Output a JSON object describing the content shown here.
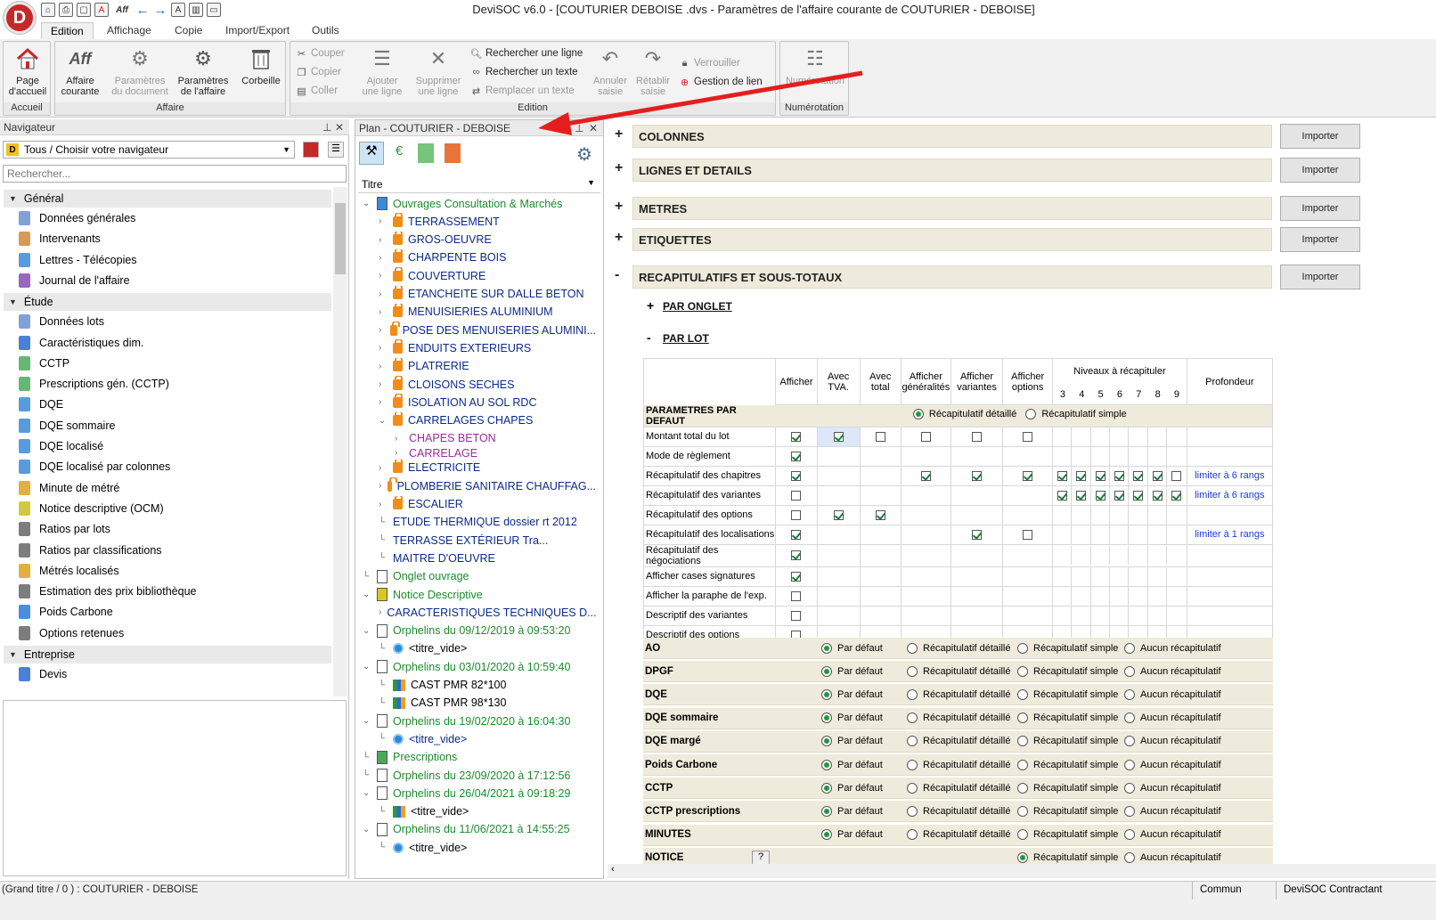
{
  "window": {
    "title": "DeviSOC v6.0 - [COUTURIER DEBOISE .dvs - Paramètres de l'affaire courante de COUTURIER - DEBOISE]",
    "logo_letter": "D"
  },
  "quick_access": [
    "home-icon",
    "print-icon",
    "new-icon",
    "pdf-icon",
    "aff-icon",
    "back-icon",
    "forward-icon",
    "a-icon",
    "layout-icon",
    "window-icon"
  ],
  "tabs": [
    "Edition",
    "Affichage",
    "Copie",
    "Import/Export",
    "Outils"
  ],
  "ribbon": {
    "accueil": {
      "label": "Accueil",
      "btn": "Page\nd'accueil"
    },
    "affaire": {
      "label": "Affaire",
      "aff": "Affaire\ncourante",
      "params_doc": "Paramètres\ndu document",
      "params_aff": "Paramètres\nde l'affaire",
      "corbeille": "Corbeille"
    },
    "edition": {
      "label": "Edition",
      "couper": "Couper",
      "copier": "Copier",
      "coller": "Coller",
      "ajouter": "Ajouter\nune ligne",
      "supprimer": "Supprimer\nune ligne",
      "rech_ligne": "Rechercher une ligne",
      "rech_texte": "Rechercher un texte",
      "remplacer": "Remplacer un texte",
      "annuler": "Annuler\nsaisie",
      "retablir": "Rétablir\nsaisie",
      "verrouiller": "Verrouiller",
      "gestion_lien": "Gestion de lien"
    },
    "numerotation": {
      "label": "Numérotation",
      "btn": "Numérotation"
    }
  },
  "navigator": {
    "title": "Navigateur",
    "selector": "Tous / Choisir votre navigateur",
    "search_placeholder": "Rechercher...",
    "groups": [
      {
        "name": "Général",
        "items": [
          "Données générales",
          "Intervenants",
          "Lettres - Télécopies",
          "Journal de l'affaire"
        ]
      },
      {
        "name": "Étude",
        "items": [
          "Données lots",
          "Caractéristiques dim.",
          "CCTP",
          "Prescriptions gén. (CCTP)",
          "DQE",
          "DQE sommaire",
          "DQE localisé",
          "DQE localisé par colonnes",
          "Minute de métré",
          "Notice descriptive (OCM)",
          "Ratios par lots",
          "Ratios par classifications",
          "Métrés localisés",
          "Estimation des prix bibliothèque",
          "Poids Carbone",
          "Options retenues"
        ]
      },
      {
        "name": "Entreprise",
        "items": [
          "Devis"
        ]
      }
    ]
  },
  "plan": {
    "title": "Plan - COUTURIER - DEBOISE",
    "column": "Titre",
    "rows": [
      {
        "t": "Ouvrages Consultation & Marchés",
        "lvl": 0,
        "c": "green",
        "ic": "doc-blue",
        "exp": "v"
      },
      {
        "t": "TERRASSEMENT",
        "lvl": 1,
        "c": "navy",
        "ic": "lock",
        "exp": ">"
      },
      {
        "t": "GROS-OEUVRE",
        "lvl": 1,
        "c": "navy",
        "ic": "lock",
        "exp": ">"
      },
      {
        "t": "CHARPENTE BOIS",
        "lvl": 1,
        "c": "navy",
        "ic": "lock",
        "exp": ">"
      },
      {
        "t": "COUVERTURE",
        "lvl": 1,
        "c": "navy",
        "ic": "lock",
        "exp": ">"
      },
      {
        "t": "ETANCHEITE SUR  DALLE BETON",
        "lvl": 1,
        "c": "navy",
        "ic": "lock",
        "exp": ">"
      },
      {
        "t": "MENUISIERIES ALUMINIUM",
        "lvl": 1,
        "c": "navy",
        "ic": "lock",
        "exp": ">"
      },
      {
        "t": "POSE DES MENUISERIES ALUMINI...",
        "lvl": 1,
        "c": "navy",
        "ic": "lock",
        "exp": ">"
      },
      {
        "t": "ENDUITS EXTERIEURS",
        "lvl": 1,
        "c": "navy",
        "ic": "lock",
        "exp": ">"
      },
      {
        "t": "PLATRERIE",
        "lvl": 1,
        "c": "navy",
        "ic": "lock",
        "exp": ">"
      },
      {
        "t": "CLOISONS SECHES",
        "lvl": 1,
        "c": "navy",
        "ic": "lock",
        "exp": ">"
      },
      {
        "t": "ISOLATION AU SOL RDC",
        "lvl": 1,
        "c": "navy",
        "ic": "lock",
        "exp": ">"
      },
      {
        "t": "CARRELAGES CHAPES",
        "lvl": 1,
        "c": "navy",
        "ic": "lock",
        "exp": "v"
      },
      {
        "t": "CHAPES BETON",
        "lvl": 2,
        "c": "purple",
        "ic": "",
        "exp": ">"
      },
      {
        "t": "CARRELAGE",
        "lvl": 2,
        "c": "purple",
        "ic": "",
        "exp": ">"
      },
      {
        "t": "ELECTRICITE",
        "lvl": 1,
        "c": "navy",
        "ic": "lock",
        "exp": ">"
      },
      {
        "t": "PLOMBERIE SANITAIRE CHAUFFAG...",
        "lvl": 1,
        "c": "navy",
        "ic": "lock",
        "exp": ">"
      },
      {
        "t": "ESCALIER",
        "lvl": 1,
        "c": "navy",
        "ic": "lock",
        "exp": ">"
      },
      {
        "t": "ETUDE THERMIQUE dossier rt 2012",
        "lvl": 1,
        "c": "navy",
        "ic": "",
        "exp": ""
      },
      {
        "t": "TERRASSE  EXTÉRIEUR            Tra...",
        "lvl": 1,
        "c": "navy",
        "ic": "",
        "exp": ""
      },
      {
        "t": "MAITRE D'OEUVRE",
        "lvl": 1,
        "c": "navy",
        "ic": "",
        "exp": ""
      },
      {
        "t": "Onglet ouvrage",
        "lvl": 0,
        "c": "green",
        "ic": "doc",
        "exp": ""
      },
      {
        "t": "Notice Descriptive",
        "lvl": 0,
        "c": "green",
        "ic": "doc-yellow",
        "exp": "v"
      },
      {
        "t": "CARACTERISTIQUES TECHNIQUES D...",
        "lvl": 1,
        "c": "navy",
        "ic": "",
        "exp": ">"
      },
      {
        "t": "Orphelins du 09/12/2019 à 09:53:20",
        "lvl": 0,
        "c": "green",
        "ic": "doc",
        "exp": "v"
      },
      {
        "t": "<titre_vide>",
        "lvl": 1,
        "c": "black",
        "ic": "circle",
        "exp": ""
      },
      {
        "t": "Orphelins du 03/01/2020 à 10:59:40",
        "lvl": 0,
        "c": "green",
        "ic": "doc",
        "exp": "v"
      },
      {
        "t": "CAST PMR 82*100",
        "lvl": 1,
        "c": "black",
        "ic": "bars",
        "exp": ""
      },
      {
        "t": "CAST PMR 98*130",
        "lvl": 1,
        "c": "black",
        "ic": "bars",
        "exp": ""
      },
      {
        "t": "Orphelins du 19/02/2020 à 16:04:30",
        "lvl": 0,
        "c": "green",
        "ic": "doc",
        "exp": "v"
      },
      {
        "t": "<titre_vide>",
        "lvl": 1,
        "c": "navy",
        "ic": "circle",
        "exp": ""
      },
      {
        "t": "Prescriptions",
        "lvl": 0,
        "c": "green",
        "ic": "doc-green",
        "exp": ""
      },
      {
        "t": "Orphelins du 23/09/2020 à 17:12:56",
        "lvl": 0,
        "c": "green",
        "ic": "doc",
        "exp": ""
      },
      {
        "t": "Orphelins du 26/04/2021 à 09:18:29",
        "lvl": 0,
        "c": "green",
        "ic": "doc",
        "exp": "v"
      },
      {
        "t": "<titre_vide>",
        "lvl": 1,
        "c": "black",
        "ic": "bars",
        "exp": ""
      },
      {
        "t": "Orphelins du 11/06/2021 à 14:55:25",
        "lvl": 0,
        "c": "green",
        "ic": "doc",
        "exp": "v"
      },
      {
        "t": "<titre_vide>",
        "lvl": 1,
        "c": "black",
        "ic": "circle",
        "exp": ""
      }
    ]
  },
  "main": {
    "sections": [
      {
        "t": "COLONNES",
        "s": "+"
      },
      {
        "t": "LIGNES ET DETAILS",
        "s": "+"
      },
      {
        "t": "METRES",
        "s": "+"
      },
      {
        "t": "ETIQUETTES",
        "s": "+"
      },
      {
        "t": "RECAPITULATIFS ET SOUS-TOTAUX",
        "s": "-"
      }
    ],
    "import_label": "Importer",
    "sub": [
      {
        "t": "PAR ONGLET",
        "s": "+"
      },
      {
        "t": "PAR LOT",
        "s": "-"
      }
    ],
    "col_headers": [
      "Afficher",
      "Avec\nTVA.",
      "Avec\ntotal",
      "Afficher\ngénéralités",
      "Afficher\nvariantes",
      "Afficher\noptions",
      "Niveaux à récapituler",
      "Profondeur"
    ],
    "niveaux": [
      "3",
      "4",
      "5",
      "6",
      "7",
      "8",
      "9"
    ],
    "param_defaut": "PARAMETRES PAR DEFAUT",
    "recap_detaille": "Récapitulatif détaillé",
    "recap_simple": "Récapitulatif simple",
    "aucun": "Aucun récapitulatif",
    "par_defaut": "Par défaut",
    "rows": [
      {
        "l": "Montant total du lot",
        "c": [
          1,
          1,
          0,
          0,
          0,
          0
        ],
        "n": [],
        "p": ""
      },
      {
        "l": "Mode de règlement",
        "c": [
          1,
          null,
          null,
          null,
          null,
          null
        ],
        "n": [],
        "p": ""
      },
      {
        "l": "Récapitulatif des chapitres",
        "c": [
          1,
          null,
          null,
          1,
          1,
          1
        ],
        "n": [
          1,
          1,
          1,
          1,
          1,
          1,
          0
        ],
        "p": "limiter à 6 rangs"
      },
      {
        "l": "Récapitulatif des variantes",
        "c": [
          0,
          null,
          null,
          null,
          null,
          null
        ],
        "n": [
          1,
          1,
          1,
          1,
          1,
          1,
          1
        ],
        "p": "limiter à 6 rangs"
      },
      {
        "l": "Récapitulatif des options",
        "c": [
          0,
          1,
          1,
          null,
          null,
          null
        ],
        "n": [],
        "p": ""
      },
      {
        "l": "Récapitulatif des localisations",
        "c": [
          1,
          null,
          null,
          null,
          1,
          0
        ],
        "n": [],
        "p": "limiter à 1 rangs"
      },
      {
        "l": "Récapitulatif des négociations",
        "c": [
          1,
          null,
          null,
          null,
          null,
          null
        ],
        "n": [],
        "p": ""
      },
      {
        "l": "Afficher cases signatures",
        "c": [
          1,
          null,
          null,
          null,
          null,
          null
        ],
        "n": [],
        "p": ""
      },
      {
        "l": "Afficher la paraphe de l'exp.",
        "c": [
          0,
          null,
          null,
          null,
          null,
          null
        ],
        "n": [],
        "p": ""
      },
      {
        "l": "Descriptif des variantes",
        "c": [
          0,
          null,
          null,
          null,
          null,
          null
        ],
        "n": [],
        "p": ""
      },
      {
        "l": "Descriptif des options",
        "c": [
          0,
          null,
          null,
          null,
          null,
          null
        ],
        "n": [],
        "p": ""
      }
    ],
    "docs": [
      "AO",
      "DPGF",
      "DQE",
      "DQE sommaire",
      "DQE margé",
      "Poids Carbone",
      "CCTP",
      "CCTP prescriptions",
      "MINUTES",
      "NOTICE"
    ]
  },
  "status": {
    "left": "(Grand titre / 0 ) : COUTURIER - DEBOISE",
    "commun": "Commun",
    "product": "DeviSOC Contractant"
  }
}
